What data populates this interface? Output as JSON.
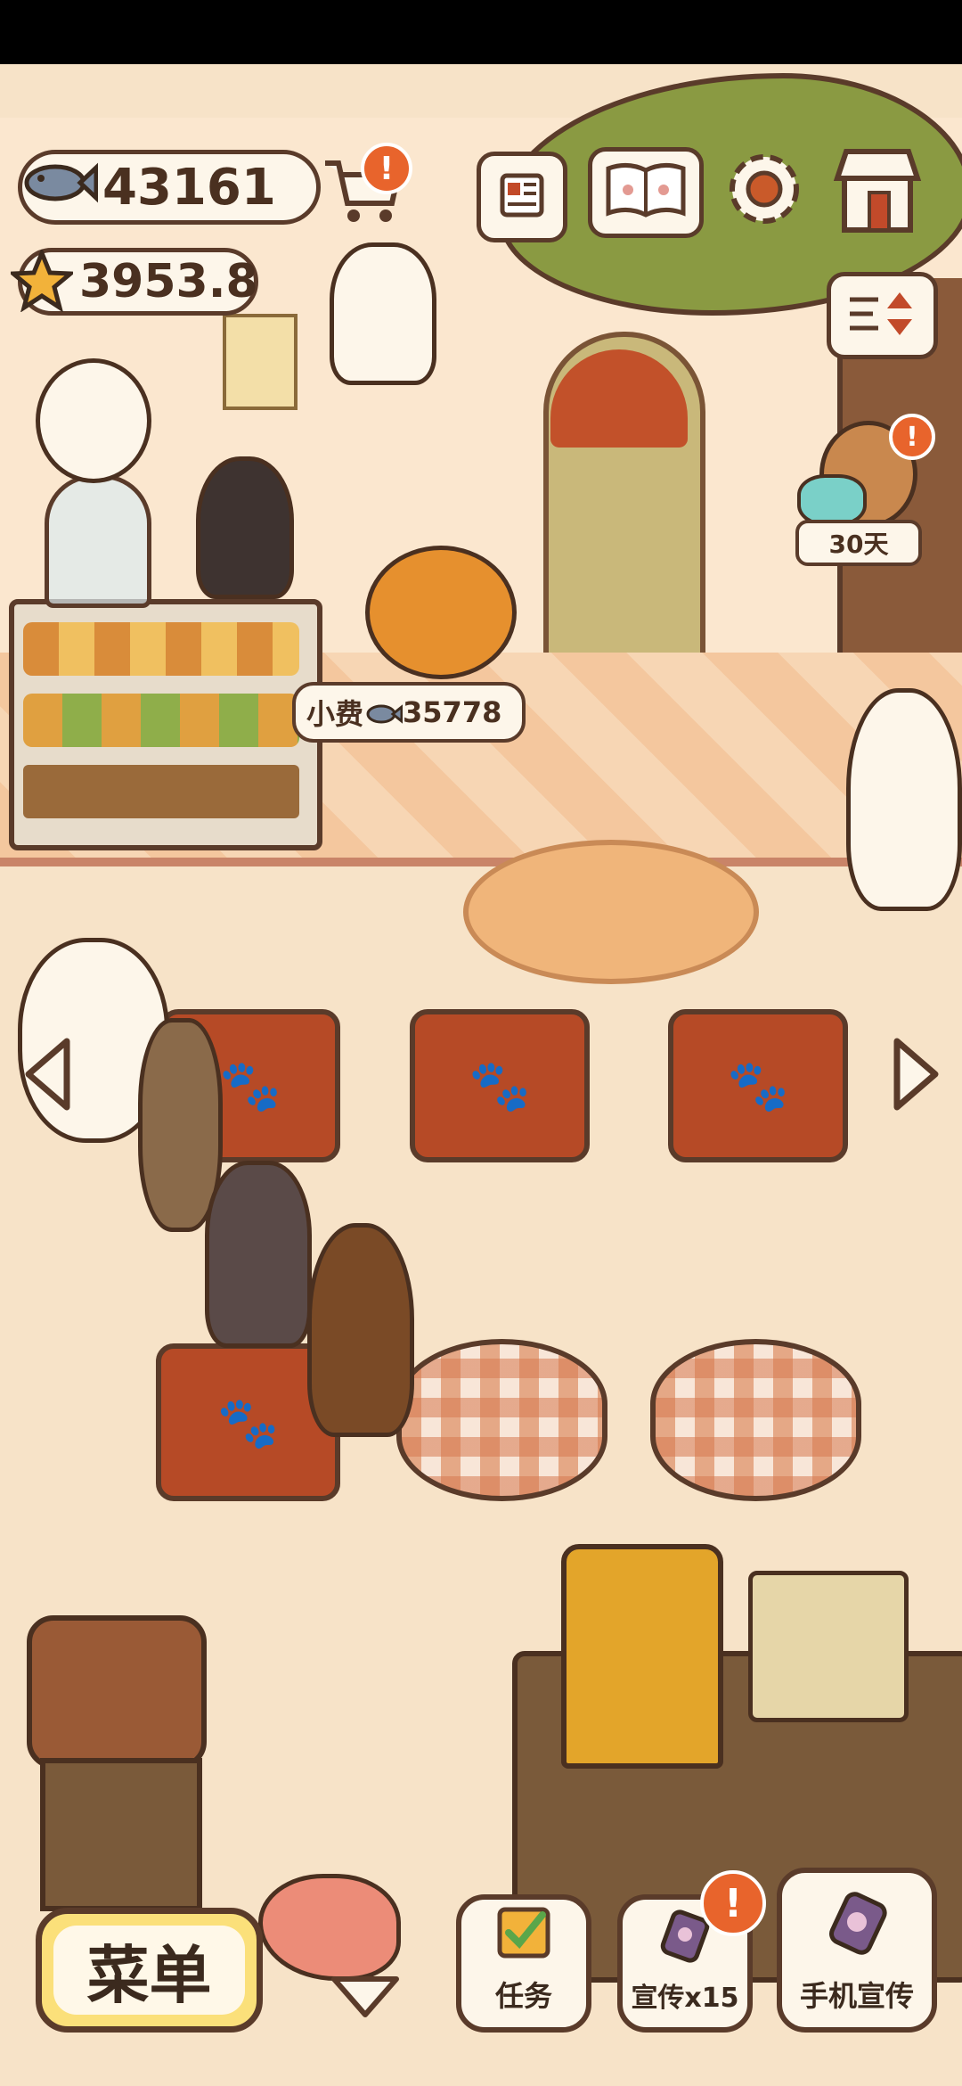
{
  "hud": {
    "fish_currency": "43161",
    "star_currency": "3953.8",
    "badge_mark": "!",
    "timer_label": "30天"
  },
  "tip_bubble": {
    "label": "小费",
    "amount": "35778"
  },
  "bottom_bar": {
    "menu_label": "菜单",
    "tasks_label": "任务",
    "promote_label": "宣传x15",
    "phone_promote_label": "手机宣传"
  },
  "colors": {
    "background": "#f7e3c8",
    "outline": "#5a3b2a",
    "badge": "#e8642c",
    "table_cloth": "#b64a26",
    "menu_button": "#fbe07a"
  },
  "icons": [
    "fish-icon",
    "star-icon",
    "cart-icon",
    "newspaper-icon",
    "recipe-book-icon",
    "settings-gear-icon",
    "shop-icon",
    "sort-toggle-icon",
    "left-arrow-icon",
    "right-arrow-icon",
    "down-arrow-icon",
    "checklist-icon",
    "phone-promo-icon"
  ]
}
